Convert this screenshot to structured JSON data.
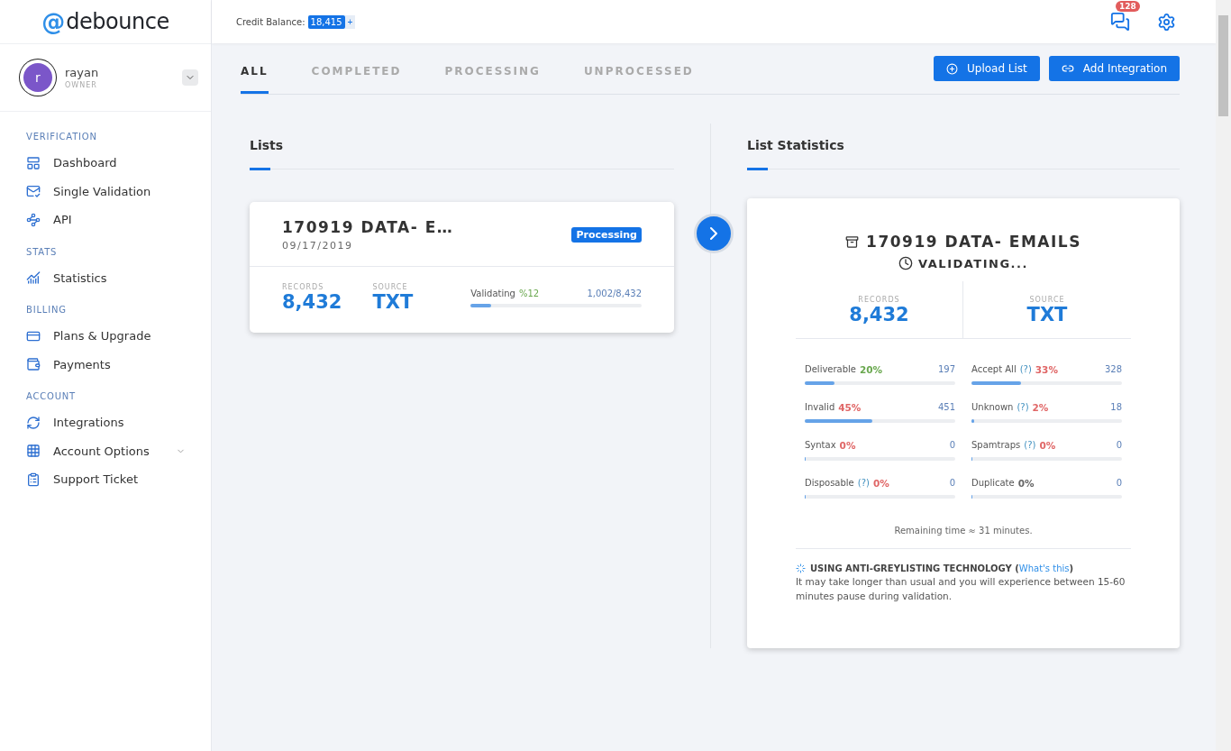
{
  "logo": {
    "mark": "@",
    "name": "debounce"
  },
  "topbar": {
    "credit_label": "Credit Balance:",
    "credit_value": "18,415",
    "credit_add": "+",
    "notifications": "128"
  },
  "user": {
    "initial": "r",
    "name": "rayan",
    "role": "OWNER"
  },
  "sidebar": [
    {
      "title": "VERIFICATION",
      "items": [
        {
          "label": "Dashboard"
        },
        {
          "label": "Single Validation"
        },
        {
          "label": "API"
        }
      ]
    },
    {
      "title": "STATS",
      "items": [
        {
          "label": "Statistics"
        }
      ]
    },
    {
      "title": "BILLING",
      "items": [
        {
          "label": "Plans & Upgrade"
        },
        {
          "label": "Payments"
        }
      ]
    },
    {
      "title": "ACCOUNT",
      "items": [
        {
          "label": "Integrations"
        },
        {
          "label": "Account Options",
          "expanded": false
        },
        {
          "label": "Support Ticket"
        }
      ]
    }
  ],
  "tabs": [
    {
      "label": "ALL",
      "selected": true
    },
    {
      "label": "COMPLETED",
      "selected": false
    },
    {
      "label": "PROCESSING",
      "selected": false
    },
    {
      "label": "UNPROCESSED",
      "selected": false
    }
  ],
  "actions": [
    "Upload List",
    "Add Integration"
  ],
  "lists": {
    "title": "Lists",
    "card": {
      "name": "170919 DATA- E…",
      "date": "09/17/2019",
      "status": "Processing",
      "records_label": "RECORDS",
      "records": "8,432",
      "source_label": "SOURCE",
      "source": "TXT",
      "progress_label": "Validating",
      "progress_pct": "%12",
      "progress_count": "1,002/8,432",
      "level": 0.12
    }
  },
  "statistics": {
    "title": "List Statistics",
    "name": "170919 DATA- EMAILS",
    "state": "VALIDATING...",
    "records_label": "RECORDS",
    "records": "8,432",
    "source_label": "SOURCE",
    "source": "TXT",
    "items": [
      {
        "label": "Deliverable",
        "percent": "20%",
        "color": "#6aa84f",
        "count": "197",
        "level": 0.2
      },
      {
        "label": "Accept All",
        "help": "(?)",
        "percent": "33%",
        "color": "#e06666",
        "count": "328",
        "level": 0.33
      },
      {
        "label": "Invalid",
        "percent": "45%",
        "color": "#e06666",
        "count": "451",
        "level": 0.45
      },
      {
        "label": "Unknown",
        "help": "(?)",
        "percent": "2%",
        "color": "#e06666",
        "count": "18",
        "level": 0.02
      },
      {
        "label": "Syntax",
        "percent": "0%",
        "color": "#e06666",
        "count": "0",
        "level": 0
      },
      {
        "label": "Spamtraps",
        "help": "(?)",
        "percent": "0%",
        "color": "#e06666",
        "count": "0",
        "level": 0
      },
      {
        "label": "Disposable",
        "help": "(?)",
        "percent": "0%",
        "color": "#e06666",
        "count": "0",
        "level": 0
      },
      {
        "label": "Duplicate",
        "percent": "0%",
        "color": "#666666",
        "count": "0",
        "level": 0
      }
    ],
    "remaining": "Remaining time ≈ 31 minutes.",
    "notice": {
      "heading": "USING ANTI-GREYLISTING TECHNOLOGY (",
      "link": "What's this",
      "after": ")",
      "text": "It may take longer than usual and you will experience between 15-60 minutes pause during validation."
    }
  }
}
